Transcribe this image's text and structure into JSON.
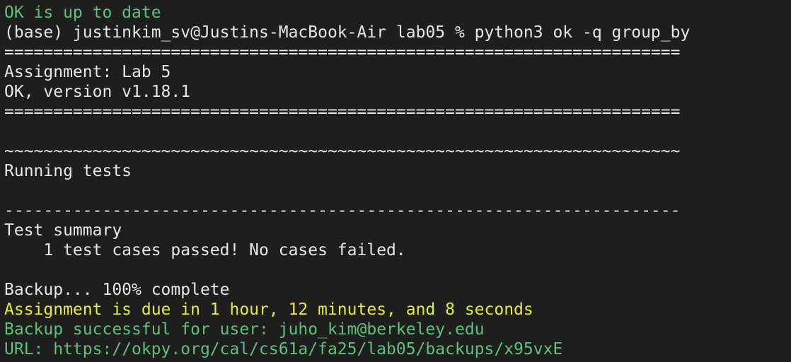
{
  "colors": {
    "background": "#1e1e1e",
    "text": "#e6e6e6",
    "green": "#5fc17a",
    "yellow": "#e7e93b"
  },
  "lines": [
    {
      "text": "OK is up to date",
      "color": "green"
    },
    {
      "text": "(base) justinkim_sv@Justins-MacBook-Air lab05 % python3 ok -q group_by",
      "color": "white"
    },
    {
      "text": "=====================================================================",
      "color": "white"
    },
    {
      "text": "Assignment: Lab 5",
      "color": "white"
    },
    {
      "text": "OK, version v1.18.1",
      "color": "white"
    },
    {
      "text": "=====================================================================",
      "color": "white"
    },
    {
      "text": "",
      "color": "white"
    },
    {
      "text": "~~~~~~~~~~~~~~~~~~~~~~~~~~~~~~~~~~~~~~~~~~~~~~~~~~~~~~~~~~~~~~~~~~~~~",
      "color": "white"
    },
    {
      "text": "Running tests",
      "color": "white"
    },
    {
      "text": "",
      "color": "white"
    },
    {
      "text": "---------------------------------------------------------------------",
      "color": "white"
    },
    {
      "text": "Test summary",
      "color": "white"
    },
    {
      "text": "    1 test cases passed! No cases failed.",
      "color": "white"
    },
    {
      "text": "",
      "color": "white"
    },
    {
      "text": "Backup... 100% complete",
      "color": "white"
    },
    {
      "text": "Assignment is due in 1 hour, 12 minutes, and 8 seconds",
      "color": "yellow"
    },
    {
      "text": "Backup successful for user: juho_kim@berkeley.edu",
      "color": "green"
    },
    {
      "text": "URL: https://okpy.org/cal/cs61a/fa25/lab05/backups/x95vxE",
      "color": "green"
    }
  ]
}
